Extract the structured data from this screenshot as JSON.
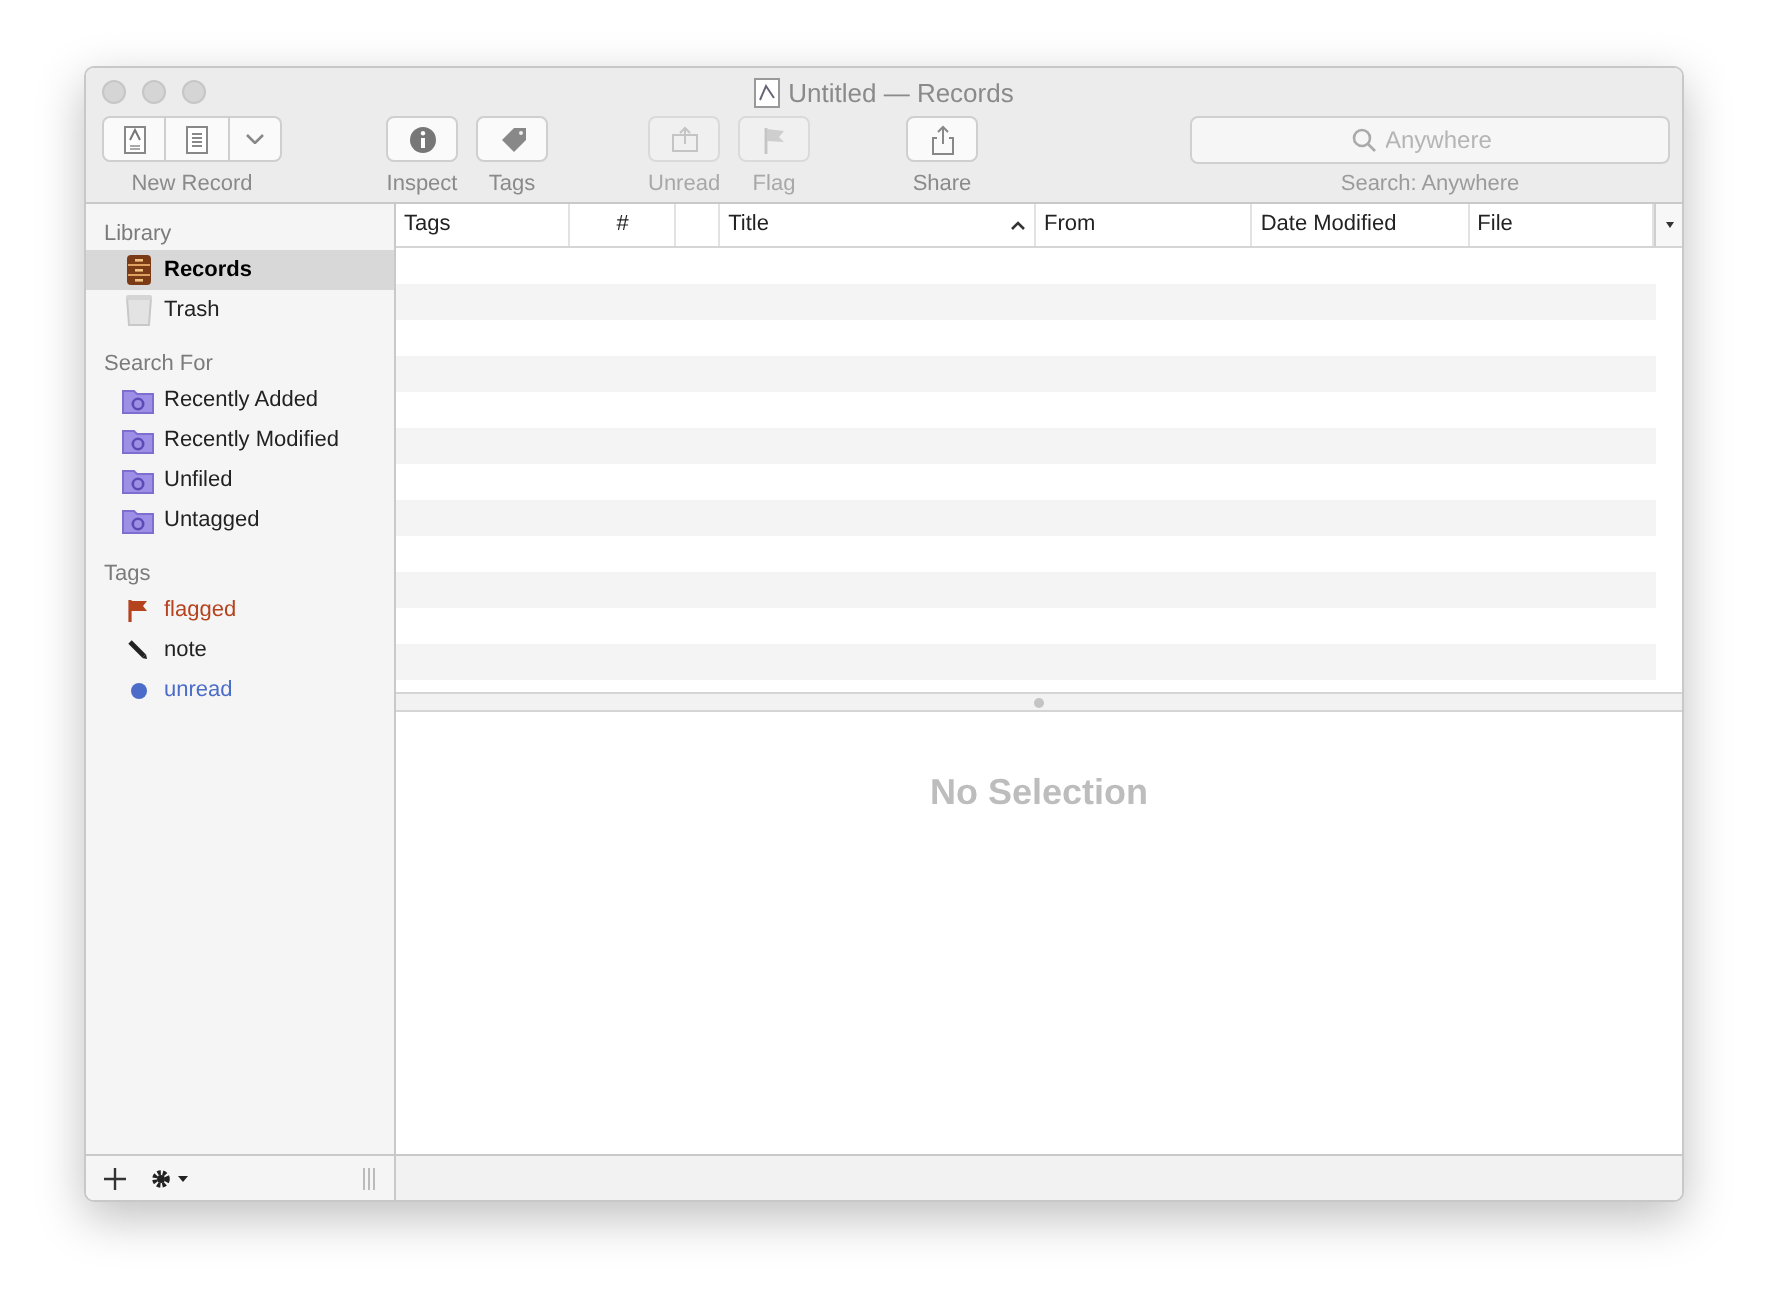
{
  "window": {
    "title": "Untitled — Records"
  },
  "toolbar": {
    "groups": [
      {
        "label": "New Record",
        "disabled": false,
        "buttons": [
          {
            "kind": "doc-a"
          },
          {
            "kind": "doc"
          },
          {
            "kind": "chevron"
          }
        ]
      },
      {
        "label": "Inspect",
        "disabled": false,
        "buttons": [
          {
            "kind": "info"
          }
        ]
      },
      {
        "label": "Tags",
        "disabled": false,
        "buttons": [
          {
            "kind": "tag"
          }
        ]
      },
      {
        "label": "Unread",
        "disabled": true,
        "buttons": [
          {
            "kind": "tray"
          }
        ]
      },
      {
        "label": "Flag",
        "disabled": true,
        "buttons": [
          {
            "kind": "flag"
          }
        ]
      },
      {
        "label": "Share",
        "disabled": false,
        "buttons": [
          {
            "kind": "share"
          }
        ]
      }
    ],
    "search": {
      "placeholder": "Anywhere",
      "label": "Search: Anywhere"
    }
  },
  "sidebar": {
    "sections": [
      {
        "title": "Library",
        "items": [
          {
            "label": "Records",
            "kind": "cabinet",
            "selected": true
          },
          {
            "label": "Trash",
            "kind": "trash",
            "selected": false
          }
        ]
      },
      {
        "title": "Search For",
        "items": [
          {
            "label": "Recently Added",
            "kind": "smart-folder",
            "selected": false
          },
          {
            "label": "Recently Modified",
            "kind": "smart-folder",
            "selected": false
          },
          {
            "label": "Unfiled",
            "kind": "smart-folder",
            "selected": false
          },
          {
            "label": "Untagged",
            "kind": "smart-folder",
            "selected": false
          }
        ]
      },
      {
        "title": "Tags",
        "items": [
          {
            "label": "flagged",
            "kind": "flag",
            "color": "#b5431d",
            "selected": false
          },
          {
            "label": "note",
            "kind": "pencil",
            "color": "#222222",
            "selected": false
          },
          {
            "label": "unread",
            "kind": "dot",
            "color": "#4b6cc8",
            "selected": false
          }
        ]
      }
    ]
  },
  "table": {
    "columns": [
      {
        "label": "Tags",
        "sorted": false
      },
      {
        "label": "#",
        "sorted": false
      },
      {
        "sorted": false
      },
      {
        "label": "Title",
        "sorted": true
      },
      {
        "label": "From",
        "sorted": false
      },
      {
        "label": "Date Modified",
        "sorted": false
      },
      {
        "label": "File",
        "sorted": false
      }
    ]
  },
  "detail": {
    "message": "No Selection"
  }
}
